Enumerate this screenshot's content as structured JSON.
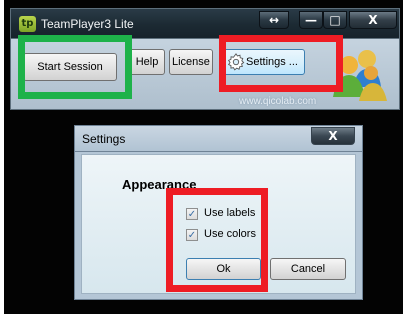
{
  "main_window": {
    "title": "TeamPlayer3 Lite",
    "logo_text": "tp",
    "titlebar_buttons": {
      "resize": "↔",
      "minimize": "—",
      "maximize": "□",
      "close": "X"
    },
    "buttons": {
      "start_session": "Start Session",
      "help": "Help",
      "license": "License",
      "settings": "Settings ..."
    },
    "website": "www.qicolab.com"
  },
  "dialog": {
    "title": "Settings",
    "close": "X",
    "section_heading": "Appearance",
    "options": [
      {
        "label": "Use labels",
        "checked": true,
        "mark": "✓"
      },
      {
        "label": "Use colors",
        "checked": true,
        "mark": "✓"
      }
    ],
    "ok_button": "Ok",
    "cancel_button": "Cancel"
  },
  "highlights": {
    "green": "#1eb24a",
    "red": "#ee1c24"
  }
}
